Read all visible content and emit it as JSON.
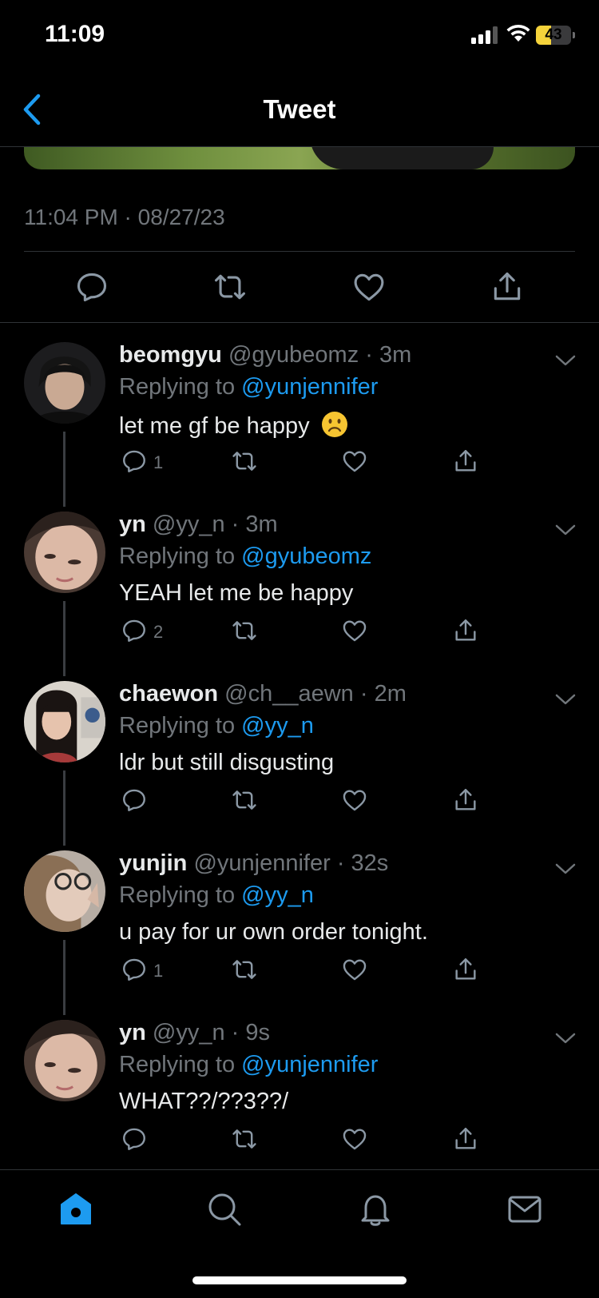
{
  "status_bar": {
    "time": "11:09",
    "battery_percent": "43",
    "battery_level": 0.43
  },
  "nav": {
    "title": "Tweet"
  },
  "tweet": {
    "timestamp": "11:04 PM · 08/27/23"
  },
  "colors": {
    "accent": "#1d9bf0",
    "text": "#e7e9ea",
    "muted": "#71767b",
    "background": "#000000",
    "battery": "#f5d33b"
  },
  "replies": [
    {
      "name": "beomgyu",
      "handle": "@gyubeomz",
      "time": "· 3m",
      "replying_prefix": "Replying to ",
      "replying_to": "@yunjennifer",
      "text": "let me gf be happy",
      "emoji": "frowning-face",
      "reply_count": "1"
    },
    {
      "name": "yn",
      "handle": "@yy_n",
      "time": "· 3m",
      "replying_prefix": "Replying to ",
      "replying_to": "@gyubeomz",
      "text": "YEAH let me be happy",
      "reply_count": "2"
    },
    {
      "name": "chaewon",
      "handle": "@ch__aewn",
      "time": "· 2m",
      "replying_prefix": "Replying to ",
      "replying_to": "@yy_n",
      "text": "ldr but still disgusting",
      "reply_count": ""
    },
    {
      "name": "yunjin",
      "handle": "@yunjennifer",
      "time": "· 32s",
      "replying_prefix": "Replying to ",
      "replying_to": "@yy_n",
      "text": "u pay for ur own order tonight.",
      "reply_count": "1"
    },
    {
      "name": "yn",
      "handle": "@yy_n",
      "time": "· 9s",
      "replying_prefix": "Replying to ",
      "replying_to": "@yunjennifer",
      "text": "WHAT??/??3??/",
      "reply_count": ""
    }
  ],
  "tab_bar": {
    "tabs": [
      "home-icon",
      "search-icon",
      "bell-icon",
      "mail-icon"
    ],
    "active": "home-icon"
  }
}
